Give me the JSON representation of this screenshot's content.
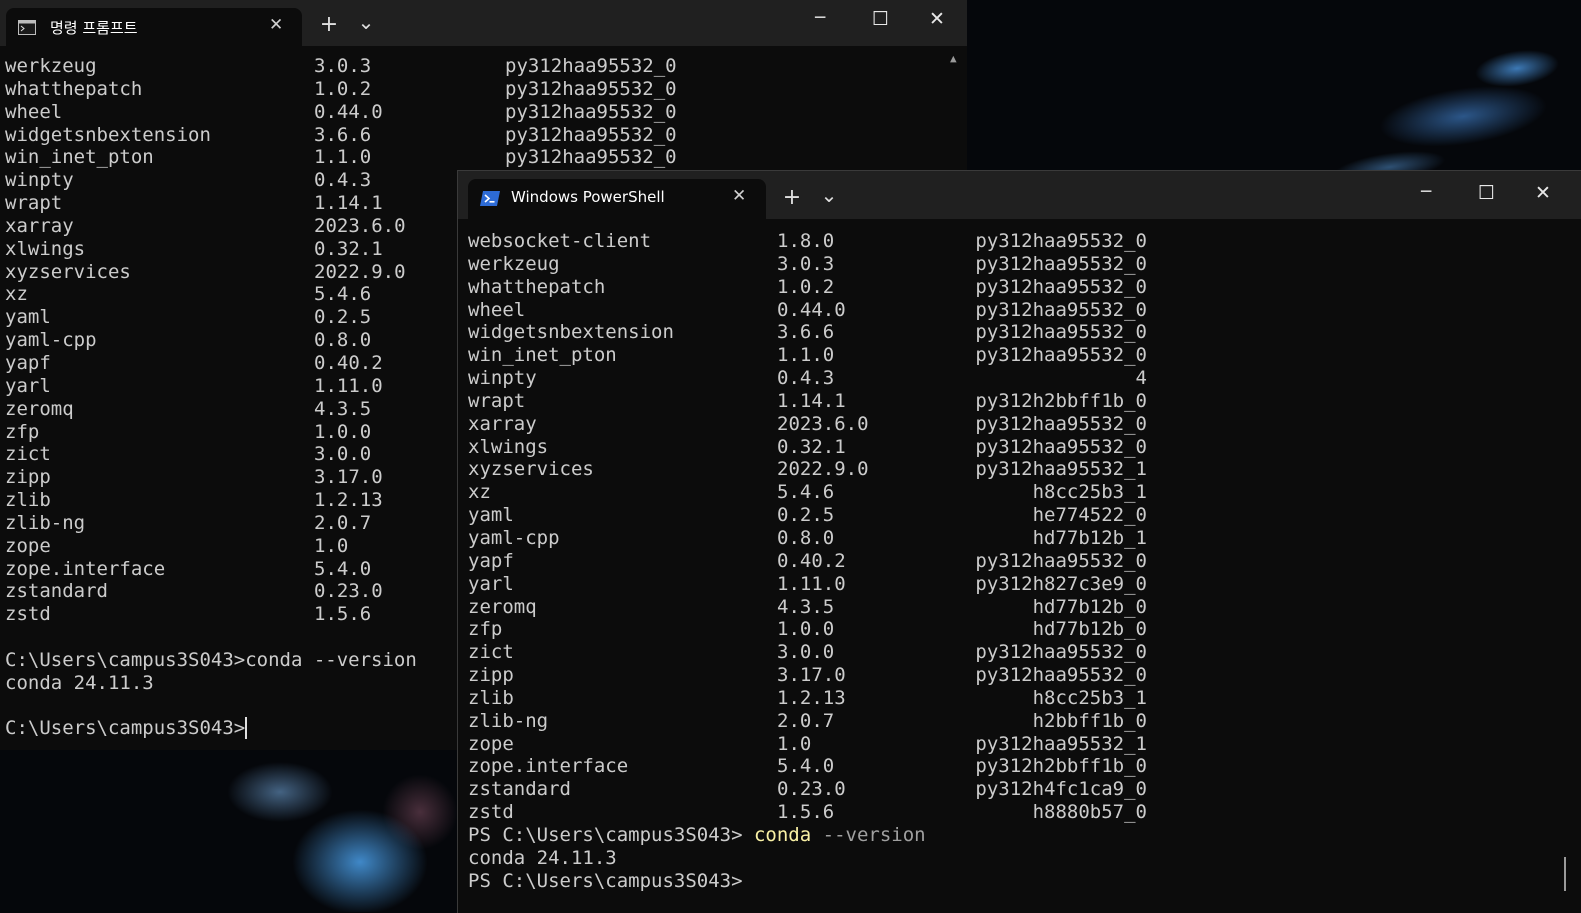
{
  "cmd": {
    "tab_title": "명령 프롬프트",
    "close_tab": "✕",
    "new_tab": "+",
    "dropdown": "⌄",
    "packages": [
      [
        "werkzeug",
        "3.0.3",
        "py312haa95532_0"
      ],
      [
        "whatthepatch",
        "1.0.2",
        "py312haa95532_0"
      ],
      [
        "wheel",
        "0.44.0",
        "py312haa95532_0"
      ],
      [
        "widgetsnbextension",
        "3.6.6",
        "py312haa95532_0"
      ],
      [
        "win_inet_pton",
        "1.1.0",
        "py312haa95532_0"
      ],
      [
        "winpty",
        "0.4.3",
        ""
      ],
      [
        "wrapt",
        "1.14.1",
        ""
      ],
      [
        "xarray",
        "2023.6.0",
        ""
      ],
      [
        "xlwings",
        "0.32.1",
        ""
      ],
      [
        "xyzservices",
        "2022.9.0",
        ""
      ],
      [
        "xz",
        "5.4.6",
        ""
      ],
      [
        "yaml",
        "0.2.5",
        ""
      ],
      [
        "yaml-cpp",
        "0.8.0",
        ""
      ],
      [
        "yapf",
        "0.40.2",
        ""
      ],
      [
        "yarl",
        "1.11.0",
        ""
      ],
      [
        "zeromq",
        "4.3.5",
        ""
      ],
      [
        "zfp",
        "1.0.0",
        ""
      ],
      [
        "zict",
        "3.0.0",
        ""
      ],
      [
        "zipp",
        "3.17.0",
        ""
      ],
      [
        "zlib",
        "1.2.13",
        ""
      ],
      [
        "zlib-ng",
        "2.0.7",
        ""
      ],
      [
        "zope",
        "1.0",
        ""
      ],
      [
        "zope.interface",
        "5.4.0",
        ""
      ],
      [
        "zstandard",
        "0.23.0",
        ""
      ],
      [
        "zstd",
        "1.5.6",
        ""
      ]
    ],
    "command_line": "C:\\Users\\campus3S043>conda --version",
    "output_line": "conda 24.11.3",
    "prompt_line": "C:\\Users\\campus3S043>"
  },
  "ps": {
    "tab_title": "Windows PowerShell",
    "close_tab": "✕",
    "new_tab": "+",
    "dropdown": "⌄",
    "packages": [
      [
        "websocket-client",
        "1.8.0",
        "py312haa95532_0"
      ],
      [
        "werkzeug",
        "3.0.3",
        "py312haa95532_0"
      ],
      [
        "whatthepatch",
        "1.0.2",
        "py312haa95532_0"
      ],
      [
        "wheel",
        "0.44.0",
        "py312haa95532_0"
      ],
      [
        "widgetsnbextension",
        "3.6.6",
        "py312haa95532_0"
      ],
      [
        "win_inet_pton",
        "1.1.0",
        "py312haa95532_0"
      ],
      [
        "winpty",
        "0.4.3",
        "4"
      ],
      [
        "wrapt",
        "1.14.1",
        "py312h2bbff1b_0"
      ],
      [
        "xarray",
        "2023.6.0",
        "py312haa95532_0"
      ],
      [
        "xlwings",
        "0.32.1",
        "py312haa95532_0"
      ],
      [
        "xyzservices",
        "2022.9.0",
        "py312haa95532_1"
      ],
      [
        "xz",
        "5.4.6",
        "h8cc25b3_1"
      ],
      [
        "yaml",
        "0.2.5",
        "he774522_0"
      ],
      [
        "yaml-cpp",
        "0.8.0",
        "hd77b12b_1"
      ],
      [
        "yapf",
        "0.40.2",
        "py312haa95532_0"
      ],
      [
        "yarl",
        "1.11.0",
        "py312h827c3e9_0"
      ],
      [
        "zeromq",
        "4.3.5",
        "hd77b12b_0"
      ],
      [
        "zfp",
        "1.0.0",
        "hd77b12b_0"
      ],
      [
        "zict",
        "3.0.0",
        "py312haa95532_0"
      ],
      [
        "zipp",
        "3.17.0",
        "py312haa95532_0"
      ],
      [
        "zlib",
        "1.2.13",
        "h8cc25b3_1"
      ],
      [
        "zlib-ng",
        "2.0.7",
        "h2bbff1b_0"
      ],
      [
        "zope",
        "1.0",
        "py312haa95532_1"
      ],
      [
        "zope.interface",
        "5.4.0",
        "py312h2bbff1b_0"
      ],
      [
        "zstandard",
        "0.23.0",
        "py312h4fc1ca9_0"
      ],
      [
        "zstd",
        "1.5.6",
        "h8880b57_0"
      ]
    ],
    "prompt": "PS C:\\Users\\campus3S043> ",
    "command": "conda",
    "argument": " --version",
    "output_line": "conda 24.11.3",
    "prompt_line": "PS C:\\Users\\campus3S043>"
  },
  "window_controls": {
    "minimize": "─",
    "maximize": "☐",
    "close": "✕"
  },
  "colors": {
    "terminal_bg": "#0c0c0c",
    "titlebar_bg": "#202020",
    "text": "#cccccc",
    "command_yellow": "#f9f1a5",
    "ps_icon_blue": "#2d6bd6"
  },
  "icons": {
    "cmd_tab_icon": "terminal-icon",
    "ps_tab_icon": "powershell-icon"
  }
}
